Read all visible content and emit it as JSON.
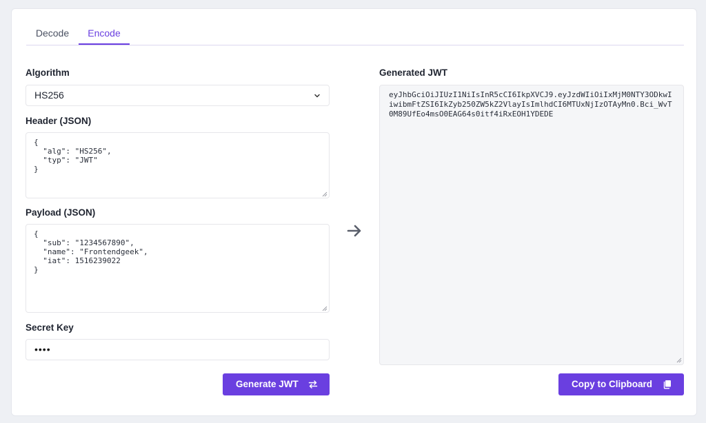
{
  "tabs": [
    {
      "label": "Decode",
      "active": false
    },
    {
      "label": "Encode",
      "active": true
    }
  ],
  "colors": {
    "accent": "#6a3fe0",
    "output_bg": "#f5f6f8"
  },
  "form": {
    "algorithm_label": "Algorithm",
    "algorithm_value": "HS256",
    "header_label": "Header (JSON)",
    "header_value": "{\n  \"alg\": \"HS256\",\n  \"typ\": \"JWT\"\n}",
    "payload_label": "Payload (JSON)",
    "payload_value": "{\n  \"sub\": \"1234567890\",\n  \"name\": \"Frontendgeek\",\n  \"iat\": 1516239022\n}",
    "secret_label": "Secret Key",
    "secret_value": "••••",
    "generate_label": "Generate JWT",
    "generate_icon": "swap-arrows-icon"
  },
  "output": {
    "label": "Generated JWT",
    "jwt": "eyJhbGciOiJIUzI1NiIsInR5cCI6IkpXVCJ9.eyJzdWIiOiIxMjM0NTY3ODkwIiwibmFtZSI6IkZyb250ZW5kZ2VlayIsImlhdCI6MTUxNjIzOTAyMn0.Bci_WvT0M89UfEo4msO0EAG64s0itf4iRxEOH1YDEDE",
    "copy_label": "Copy to Clipboard",
    "copy_icon": "copy-icon"
  }
}
